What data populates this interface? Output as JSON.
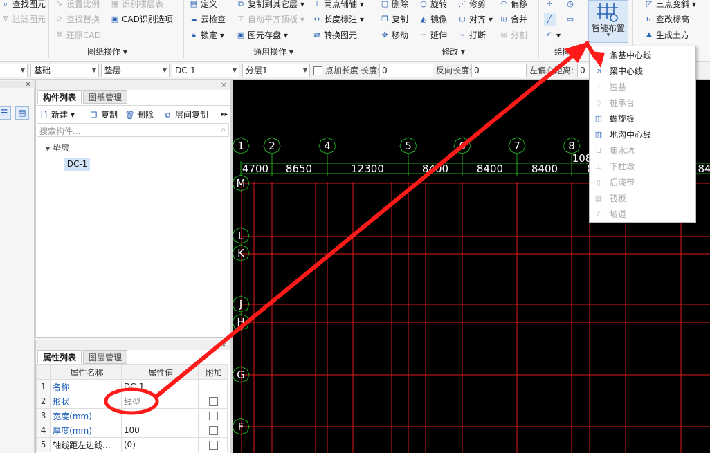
{
  "ribbon": {
    "col1": [
      "查找图元",
      "过滤图元"
    ],
    "col2": [
      "设置比例",
      "查找替换",
      "还原CAD"
    ],
    "col3": [
      "识别楼层表",
      "CAD识别选项"
    ],
    "col4": [
      "定义",
      "云检查",
      "锁定"
    ],
    "col5": [
      "复制到其它层",
      "自动平齐顶板",
      "图元存盘"
    ],
    "col6": [
      "两点辅轴",
      "长度标注",
      "转换图元"
    ],
    "col7": [
      "删除",
      "复制",
      "移动"
    ],
    "col8": [
      "旋转",
      "镜像",
      "延伸"
    ],
    "col9": [
      "修剪",
      "对齐",
      "打断"
    ],
    "col10": [
      "偏移",
      "合并",
      "分割"
    ],
    "col11": [
      "三点变斜",
      "查改标高",
      "生成土方"
    ],
    "groups": [
      "图纸操作",
      "通用操作",
      "修改",
      "绘图"
    ],
    "smart_layout_label": "智能布置"
  },
  "toolbar2": {
    "floor": "",
    "category": "基础",
    "type": "垫层",
    "component": "DC-1",
    "layer": "分层1",
    "point_length_label": "点加长度",
    "length_label": "长度:",
    "length_value": "0",
    "reverse_length_label": "反向长度:",
    "reverse_length_value": "0",
    "offset_label": "左偏心距离:",
    "offset_value": "0"
  },
  "component_panel": {
    "tabs": [
      "构件列表",
      "图纸管理"
    ],
    "buttons": [
      "新建",
      "复制",
      "删除",
      "层间复制"
    ],
    "search_placeholder": "搜索构件...",
    "tree_root": "垫层",
    "tree_child": "DC-1"
  },
  "property_panel": {
    "tabs": [
      "属性列表",
      "图层管理"
    ],
    "headers": [
      "属性名称",
      "属性值",
      "附加"
    ],
    "rows": [
      {
        "num": "1",
        "name": "名称",
        "value": "DC-1",
        "has_check": false
      },
      {
        "num": "2",
        "name": "形状",
        "value": "线型",
        "has_check": true
      },
      {
        "num": "3",
        "name": "宽度(mm)",
        "value": "",
        "has_check": true
      },
      {
        "num": "4",
        "name": "厚度(mm)",
        "value": "100",
        "has_check": true
      },
      {
        "num": "5",
        "name": "轴线距左边线...",
        "value": "(0)",
        "has_check": true
      }
    ]
  },
  "canvas": {
    "axis_top": [
      "1",
      "2",
      "4",
      "5",
      "6",
      "7",
      "8"
    ],
    "dims": [
      "4700",
      "8650",
      "12300",
      "8400",
      "8400",
      "8400",
      "108",
      "8",
      "84"
    ],
    "axis_left": [
      "M",
      "L",
      "K",
      "J",
      "H",
      "G",
      "F"
    ]
  },
  "dropdown_menu": {
    "items": [
      {
        "label": "条基中心线",
        "enabled": true
      },
      {
        "label": "梁中心线",
        "enabled": true
      },
      {
        "label": "独基",
        "enabled": false
      },
      {
        "label": "桩承台",
        "enabled": false
      },
      {
        "label": "螺旋板",
        "enabled": true
      },
      {
        "label": "地沟中心线",
        "enabled": true
      },
      {
        "label": "集水坑",
        "enabled": false
      },
      {
        "label": "下柱墩",
        "enabled": false
      },
      {
        "label": "后浇带",
        "enabled": false
      },
      {
        "label": "筏板",
        "enabled": false
      },
      {
        "label": "坡道",
        "enabled": false
      }
    ]
  },
  "colors": {
    "canvas_bg": "#000000",
    "grid_red": "#e01818",
    "grid_green": "#1fa81f",
    "annotation_red": "#ff1a1a",
    "accent_blue": "#2a64b5"
  }
}
